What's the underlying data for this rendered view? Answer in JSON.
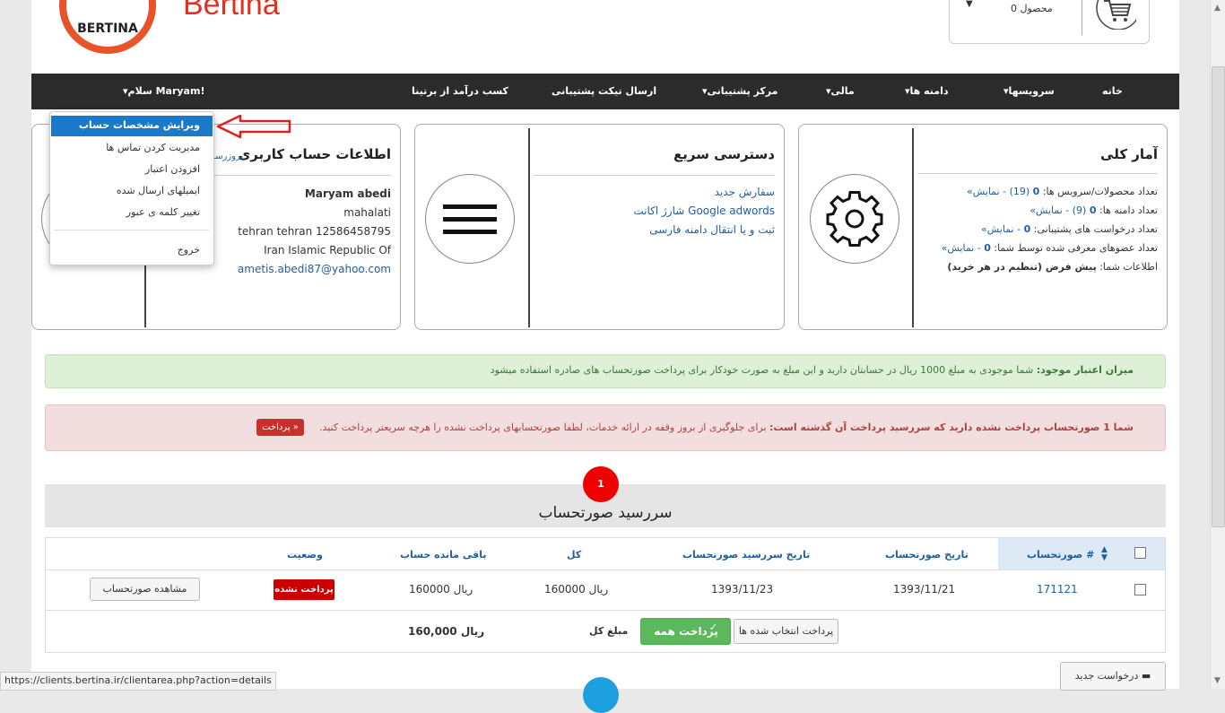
{
  "header": {
    "brand_name": "Bertina",
    "logo_text": "BERTINA",
    "cart_count": "0 محصول"
  },
  "nav": {
    "home": "خانه",
    "services": "سرویسها",
    "domains": "دامنه ها",
    "billing": "مالی",
    "support": "مرکز پشتیبانی",
    "ticket": "ارسال تیکت پشتیبانی",
    "affiliate": "کسب درآمد از برتینا",
    "user_greeting": "سلام Maryam!"
  },
  "user_menu": {
    "items": [
      "ویرایش مشخصات حساب",
      "مدیریت کردن تماس ها",
      "افزودن اعتبار",
      "ایمیلهای ارسال شده",
      "تغییر کلمه ی عبور"
    ],
    "logout": "خروج"
  },
  "stats_panel": {
    "title": "آمار کلی",
    "products_label": "تعداد محصولات/سرویس ها:",
    "products_value": "0",
    "products_extra": "(19) - نمایش»",
    "domains_label": "تعداد دامنه ها:",
    "domains_value": "0",
    "domains_extra": "(9) - نمایش»",
    "tickets_label": "تعداد درخواست های پشتیبانی:",
    "tickets_value": "0",
    "tickets_extra": "- نمایش»",
    "referrals_label": "تعداد عضوهای معرفی شده توسط شما:",
    "referrals_value": "0",
    "referrals_extra": "- نمایش»",
    "info_label": "اطلاعات شما:",
    "info_value": "پیش فرض (تنظیم در هر خرید)"
  },
  "quick_panel": {
    "title": "دسترسی سریع",
    "links": [
      "سفارش جدید",
      "شارژ اکانت Google adwords",
      "ثبت و یا انتقال دامنه فارسی"
    ]
  },
  "account_panel": {
    "title": "اطلاعات حساب کاربری",
    "update_link": "بروزرسانی",
    "name": "Maryam abedi",
    "company": "mahalati",
    "address": "tehran tehran 12586458795",
    "country": "Iran Islamic Republic Of",
    "email": "ametis.abedi87@yahoo.com"
  },
  "credit_alert": {
    "label": "میزان اعتبار موجود:",
    "text": "شما موجودی به مبلغ 1000 ریال در حسابتان دارید و این مبلغ به صورت خودکار برای پرداخت صورتحساب های صادره استفاده میشود"
  },
  "overdue_alert": {
    "bold": "شما 1 صورتحساب پرداخت نشده دارید که سررسید پرداخت آن گذشته است:",
    "text": "برای جلوگیری از بروز وقفه در ارائه خدمات، لطفا صورتحسابهای پرداخت نشده را هرچه سریعتر پرداخت کنید.",
    "pay_button": "پرداخت »"
  },
  "invoices": {
    "badge": "1",
    "title": "سررسید صورتحساب",
    "columns": [
      "صورتحساب #",
      "تاریخ صورتحساب",
      "تاریخ سررسید صورتحساب",
      "کل",
      "باقی مانده حساب",
      "وضعیت"
    ],
    "rows": [
      {
        "id": "171121",
        "date": "1393/11/21",
        "due": "1393/11/23",
        "total": "160000 ریال",
        "balance": "160000 ریال",
        "status": "پرداخت نشده",
        "view": "مشاهده صورتحساب"
      }
    ],
    "pay_selected": "پرداخت انتخاب شده ها",
    "pay_all": "پرداخت همه",
    "total_label": "مبلغ کل",
    "total_value": "160,000 ریال"
  },
  "new_ticket": "درخواست جدید",
  "statusbar_url": "https://clients.bertina.ir/clientarea.php?action=details",
  "colors": {
    "accent": "#1a79c8",
    "nav": "#2b2b2b",
    "danger": "#cc0000",
    "success": "#5cb85c"
  }
}
